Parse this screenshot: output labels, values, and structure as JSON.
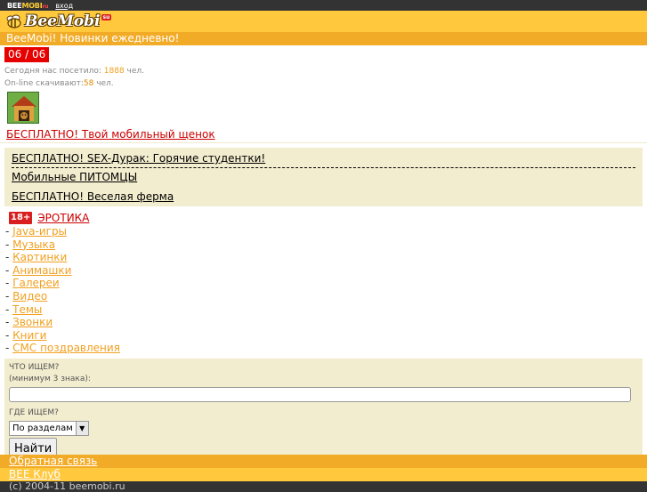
{
  "topbar": {
    "brand_bee": "BEE",
    "brand_mobi": "MOBI",
    "brand_ru": "ru",
    "login": "вход"
  },
  "header": {
    "logo_text": "BeeMobi",
    "logo_badge": "su"
  },
  "tagline": "BeeMobi! Новинки ежедневно!",
  "date": "06 / 06",
  "stats": {
    "visited_prefix": "Сегодня нас посетило: ",
    "visited_count": "1888",
    "visited_suffix": " чел.",
    "online_prefix": "On-line скачивают:",
    "online_count": "58",
    "online_suffix": " чел."
  },
  "promo_main": "БЕСПЛАТНО! Твой мобильный щенок",
  "promo_box": [
    "БЕСПЛАТНО! SEX-Дурак: Горячие студентки!",
    "Мобильные ПИТОМЦЫ",
    "БЕСПЛАТНО! Веселая ферма"
  ],
  "erotic": {
    "badge": "18+",
    "label": "ЭРОТИКА"
  },
  "categories": [
    "Java-игры",
    "Музыка",
    "Картинки",
    "Анимашки",
    "Галереи",
    "Видео",
    "Темы",
    "Звонки",
    "Книги",
    "СМС поздравления"
  ],
  "search": {
    "what_label": "ЧТО ИЩЕМ?",
    "min_label": "(минимум 3 знака):",
    "query_value": "",
    "where_label": "ГДЕ ИЩЕМ?",
    "where_value": "По разделам",
    "button": "Найти"
  },
  "footer": {
    "feedback": "Обратная связь",
    "club": "BEE Клуб",
    "copyright": "(c) 2004-11 beemobi.ru"
  },
  "colors": {
    "header": "#ffc83d",
    "stripe": "#f2ab27",
    "accent_red": "#e60000",
    "box_bg": "#f3edcf"
  }
}
